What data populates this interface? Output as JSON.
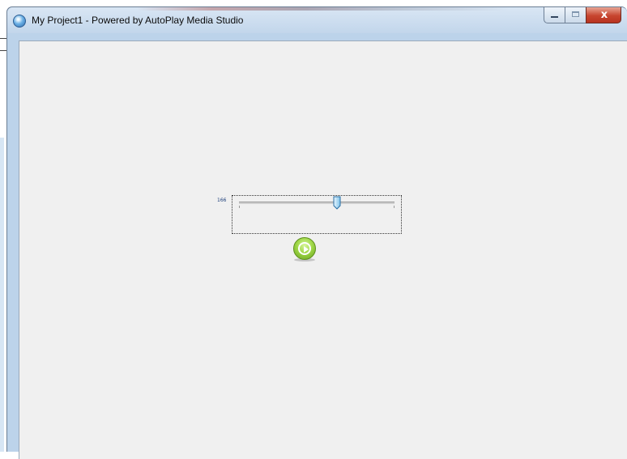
{
  "window": {
    "title": "My Project1 - Powered by AutoPlay Media Studio",
    "app_icon": "globe-icon",
    "caption_buttons": {
      "minimize_icon": "minimize-icon",
      "maximize_icon": "maximize-icon",
      "close_icon": "close-icon",
      "close_label": "x"
    }
  },
  "slider": {
    "value_text": "166",
    "value": 166,
    "thumb_icon": "slider-thumb-icon"
  },
  "play_button": {
    "icon": "play-icon"
  },
  "colors": {
    "accent_green": "#9fd747",
    "titlebar": "#c2d6eb",
    "close_red": "#c7452f",
    "client_bg": "#f0f0f0"
  }
}
